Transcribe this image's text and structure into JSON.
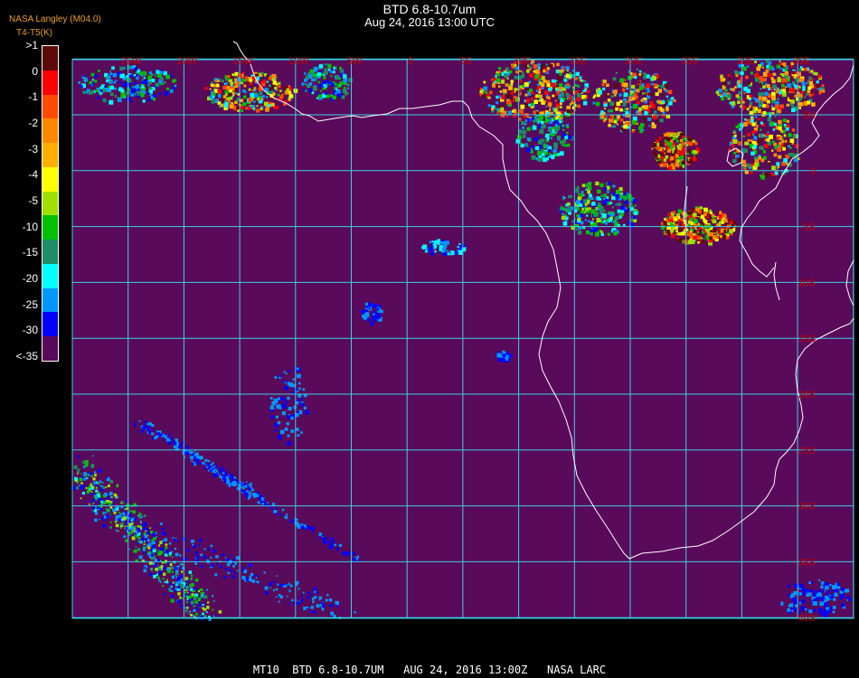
{
  "header": {
    "title": "BTD 6.8-10.7um",
    "datetime": "Aug 24, 2016 13:00 UTC",
    "credit": "NASA Langley (M04.0)",
    "units": "T4-T5(K)"
  },
  "legend": {
    "labels": [
      ">1",
      "0",
      "-1",
      "-2",
      "-3",
      "-4",
      "-5",
      "-10",
      "-15",
      "-20",
      "-25",
      "-30",
      "<-35"
    ],
    "colors": [
      "#5c0a0a",
      "#ff0000",
      "#ff4a00",
      "#ff8a00",
      "#ffb000",
      "#ffff00",
      "#a0e000",
      "#00c000",
      "#1e8c64",
      "#00ffff",
      "#0096ff",
      "#0000ff",
      "#5a0a5a"
    ]
  },
  "map": {
    "background_color": "#5a0a5a",
    "grid_color": "#3ad0e6",
    "coast_color": "#ffffff",
    "label_color": "#c00000",
    "lon_labels": [
      "25W",
      "20W",
      "15W",
      "10W",
      "5W",
      "0",
      "5E",
      "10E",
      "15E",
      "20E",
      "25E",
      "30E",
      "35E"
    ],
    "lat_labels": [
      "5N",
      "0",
      "5S",
      "10S",
      "15S",
      "20S",
      "25S",
      "30S",
      "35S",
      "40S"
    ]
  },
  "footer": {
    "text": "MT10  BTD 6.8-10.7UM   AUG 24, 2016 13:00Z   NASA LARC"
  }
}
